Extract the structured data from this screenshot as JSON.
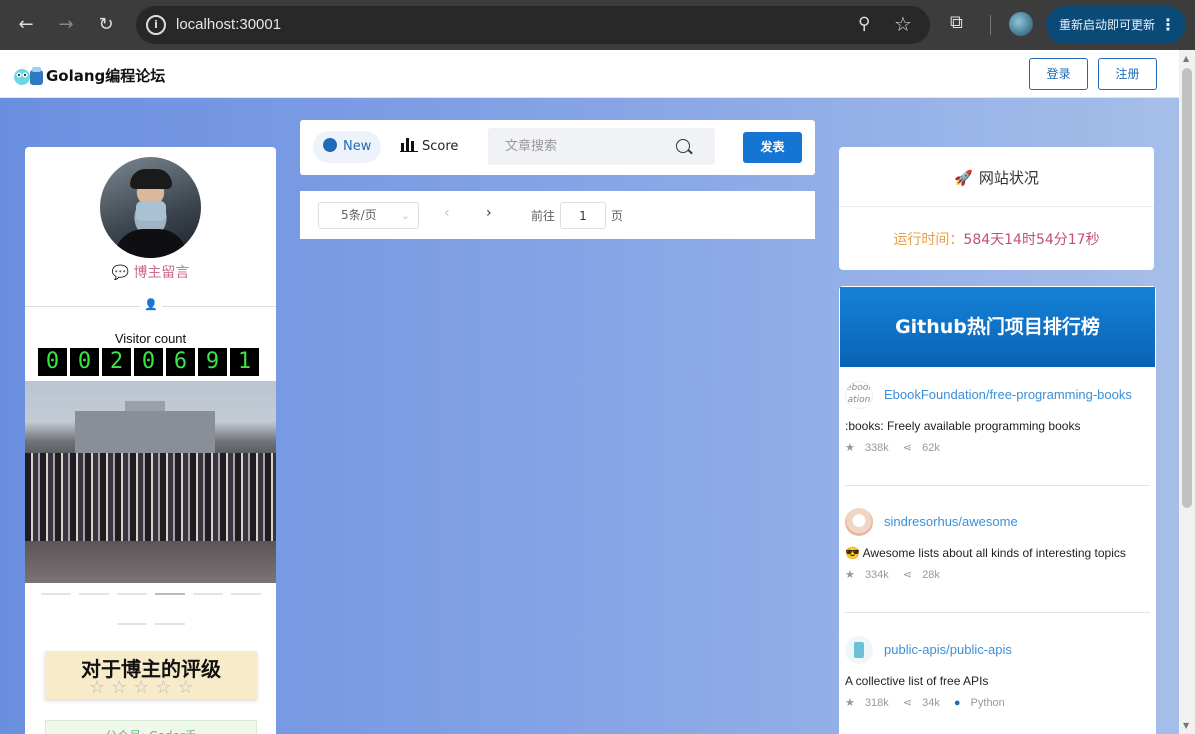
{
  "browser": {
    "url": "localhost:30001",
    "update_label": "重新启动即可更新"
  },
  "header": {
    "title": "Golang编程论坛",
    "login_label": "登录",
    "register_label": "注册"
  },
  "profile": {
    "message_label_icon": "💬",
    "message_label": "博主留言",
    "visitor_label": "Visitor count",
    "visitor_digits": [
      "0",
      "0",
      "2",
      "0",
      "6",
      "9",
      "1"
    ],
    "rating_title": "对于博主的评级",
    "rating_stars": 0,
    "rating_max": 5,
    "wechat_label": "公众号: Coder手"
  },
  "toolbar": {
    "tab_new": "New",
    "tab_score": "Score",
    "search_placeholder": "文章搜索",
    "post_label": "发表"
  },
  "pager": {
    "page_size": "5条/页",
    "goto_label": "前往",
    "page_value": "1",
    "goto_suffix": "页"
  },
  "status": {
    "title": "网站状况",
    "uptime_label": "运行时间：",
    "uptime_value": "584天14时54分17秒"
  },
  "github": {
    "title": "Github热门项目排行榜",
    "repos": [
      {
        "name": "EbookFoundation/free-programming-books",
        "desc": ":books: Freely available programming books",
        "stars": "338k",
        "forks": "62k",
        "lang": ""
      },
      {
        "name": "sindresorhus/awesome",
        "desc": "😎 Awesome lists about all kinds of interesting topics",
        "stars": "334k",
        "forks": "28k",
        "lang": ""
      },
      {
        "name": "public-apis/public-apis",
        "desc": "A collective list of free APIs",
        "stars": "318k",
        "forks": "34k",
        "lang": "Python"
      }
    ]
  }
}
